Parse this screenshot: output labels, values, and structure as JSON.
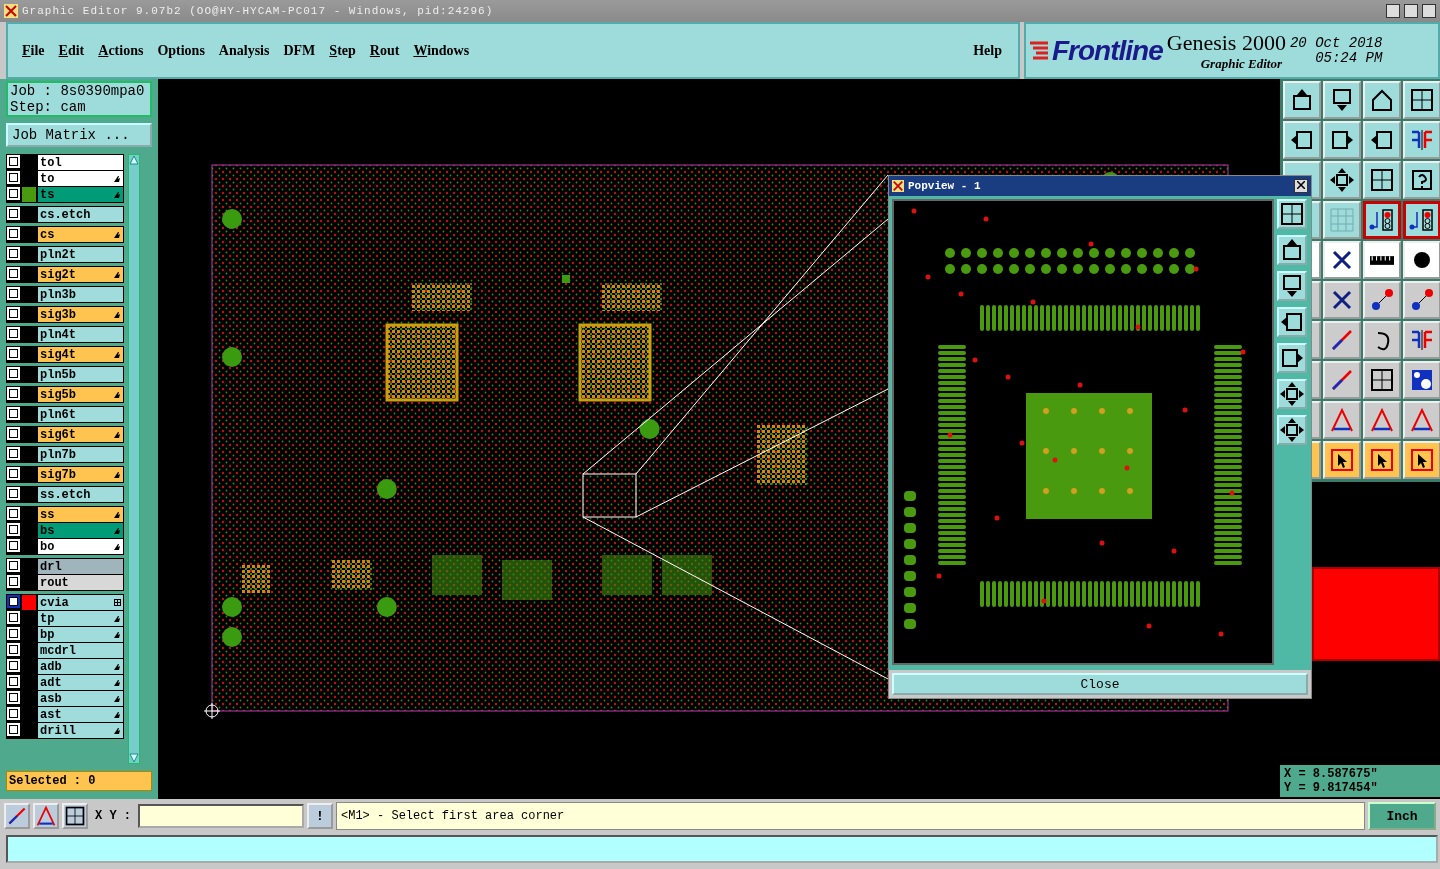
{
  "window": {
    "title": "Graphic Editor 9.07b2 (OO@HY-HYCAM-PC017 - Windows, pid:24296)"
  },
  "menu": [
    {
      "label": "File",
      "mnemonic": true
    },
    {
      "label": "Edit",
      "mnemonic": true
    },
    {
      "label": "Actions",
      "mnemonic": true
    },
    {
      "label": "Options",
      "mnemonic": false
    },
    {
      "label": "Analysis",
      "mnemonic": false
    },
    {
      "label": "DFM",
      "mnemonic": false
    },
    {
      "label": "Step",
      "mnemonic": true
    },
    {
      "label": "Rout",
      "mnemonic": true
    },
    {
      "label": "Windows",
      "mnemonic": true
    }
  ],
  "help": "Help",
  "brand": {
    "logo": "Frontline",
    "product": "Genesis 2000",
    "subtitle": "Graphic Editor",
    "date": "20 Oct 2018",
    "time": "05:24 PM"
  },
  "job": {
    "job": "Job : 8s0390mpa0",
    "step": "Step: cam",
    "matrix_button": "Job Matrix ..."
  },
  "layer_groups": [
    {
      "layers": [
        {
          "name": "tol",
          "color": "#ffffff",
          "kind": "plain",
          "active": false
        },
        {
          "name": "to",
          "color": "#ffffff",
          "kind": "hand",
          "active": false
        },
        {
          "name": "ts",
          "color": "#009b77",
          "swatch": {
            "color": "#4a9a10"
          },
          "kind": "hand",
          "active": false
        }
      ]
    },
    {
      "layers": [
        {
          "name": "cs.etch",
          "color": "#a0dcdc",
          "kind": "plain",
          "active": false
        }
      ]
    },
    {
      "layers": [
        {
          "name": "cs",
          "color": "#ffc450",
          "kind": "hand",
          "active": false
        }
      ]
    },
    {
      "layers": [
        {
          "name": "pln2t",
          "color": "#a0dcdc",
          "kind": "plain",
          "active": false
        }
      ]
    },
    {
      "layers": [
        {
          "name": "sig2t",
          "color": "#ffc450",
          "kind": "hand",
          "active": false
        }
      ]
    },
    {
      "layers": [
        {
          "name": "pln3b",
          "color": "#a0dcdc",
          "kind": "plain",
          "active": false
        }
      ]
    },
    {
      "layers": [
        {
          "name": "sig3b",
          "color": "#ffc450",
          "kind": "hand",
          "active": false
        }
      ]
    },
    {
      "layers": [
        {
          "name": "pln4t",
          "color": "#a0dcdc",
          "kind": "plain",
          "active": false
        }
      ]
    },
    {
      "layers": [
        {
          "name": "sig4t",
          "color": "#ffc450",
          "kind": "hand",
          "active": false
        }
      ]
    },
    {
      "layers": [
        {
          "name": "pln5b",
          "color": "#a0dcdc",
          "kind": "plain",
          "active": false
        }
      ]
    },
    {
      "layers": [
        {
          "name": "sig5b",
          "color": "#ffc450",
          "kind": "hand",
          "active": false
        }
      ]
    },
    {
      "layers": [
        {
          "name": "pln6t",
          "color": "#a0dcdc",
          "kind": "plain",
          "active": false
        }
      ]
    },
    {
      "layers": [
        {
          "name": "sig6t",
          "color": "#ffc450",
          "kind": "hand",
          "active": false
        }
      ]
    },
    {
      "layers": [
        {
          "name": "pln7b",
          "color": "#a0dcdc",
          "kind": "plain",
          "active": false
        }
      ]
    },
    {
      "layers": [
        {
          "name": "sig7b",
          "color": "#ffc450",
          "kind": "hand",
          "active": false
        }
      ]
    },
    {
      "layers": [
        {
          "name": "ss.etch",
          "color": "#a0dcdc",
          "kind": "plain",
          "active": false
        }
      ]
    },
    {
      "layers": [
        {
          "name": "ss",
          "color": "#ffc450",
          "kind": "hand",
          "active": false
        },
        {
          "name": "bs",
          "color": "#009b77",
          "kind": "hand",
          "active": false
        },
        {
          "name": "bo",
          "color": "#ffffff",
          "kind": "hand",
          "active": false
        }
      ]
    },
    {
      "layers": [
        {
          "name": "drl",
          "color": "#a0b4bc",
          "kind": "plain",
          "active": false
        },
        {
          "name": "rout",
          "color": "#d8d8d8",
          "kind": "plain",
          "active": false
        }
      ]
    },
    {
      "layers": [
        {
          "name": "cvia",
          "color": "#a0dcdc",
          "swatch": {
            "color": "#ff0000"
          },
          "kind": "grid",
          "active": true
        },
        {
          "name": "tp",
          "color": "#a0dcdc",
          "kind": "hand",
          "active": false
        },
        {
          "name": "bp",
          "color": "#a0dcdc",
          "kind": "hand",
          "active": false
        },
        {
          "name": "mcdrl",
          "color": "#a0dcdc",
          "kind": "plain",
          "active": false
        },
        {
          "name": "adb",
          "color": "#a0dcdc",
          "kind": "hand",
          "active": false
        },
        {
          "name": "adt",
          "color": "#a0dcdc",
          "kind": "hand",
          "active": false
        },
        {
          "name": "asb",
          "color": "#a0dcdc",
          "kind": "hand",
          "active": false
        },
        {
          "name": "ast",
          "color": "#a0dcdc",
          "kind": "hand",
          "active": false
        },
        {
          "name": "drill",
          "color": "#a0dcdc",
          "kind": "hand",
          "active": false
        }
      ]
    }
  ],
  "selected_count": "Selected : 0",
  "popview": {
    "title": "Popview - 1",
    "close_button": "Close"
  },
  "coordinates": {
    "x": "X = 8.587675\"",
    "y": "Y = 9.817454\""
  },
  "command_bar": {
    "xy_label": "X Y :",
    "bang": "!",
    "message": "<M1> - Select first area corner",
    "units": "Inch"
  }
}
